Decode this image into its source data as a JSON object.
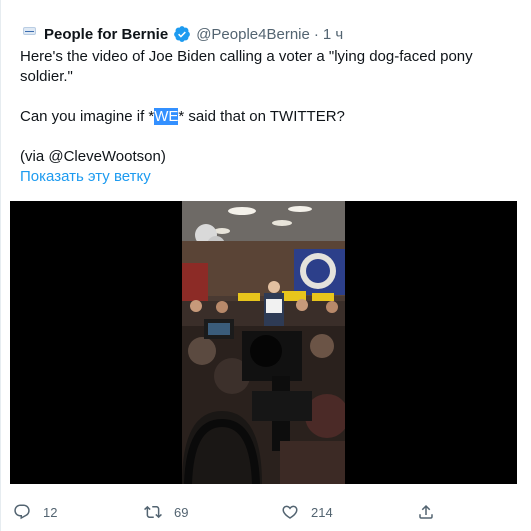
{
  "tweet": {
    "author_name": "People for Bernie",
    "handle": "@People4Bernie",
    "separator": "·",
    "time": "1 ч",
    "line1": "Here's the video of Joe Biden calling a voter a \"lying dog-faced pony",
    "line2": "soldier.\"",
    "line3_pre": "Can you imagine if *",
    "line3_highlight": "WE",
    "line3_post": "* said that on TWITTER?",
    "line4": "(via @CleveWootson)",
    "show_thread": "Показать эту ветку"
  },
  "actions": {
    "reply_count": "12",
    "retweet_count": "69",
    "like_count": "214"
  },
  "colors": {
    "accent": "#1d9bf0",
    "secondary_text": "#536471",
    "highlight": "#3390ff"
  },
  "icons": {
    "verified": "verified-badge-icon",
    "reply": "reply-icon",
    "retweet": "retweet-icon",
    "like": "heart-icon",
    "share": "share-icon"
  }
}
